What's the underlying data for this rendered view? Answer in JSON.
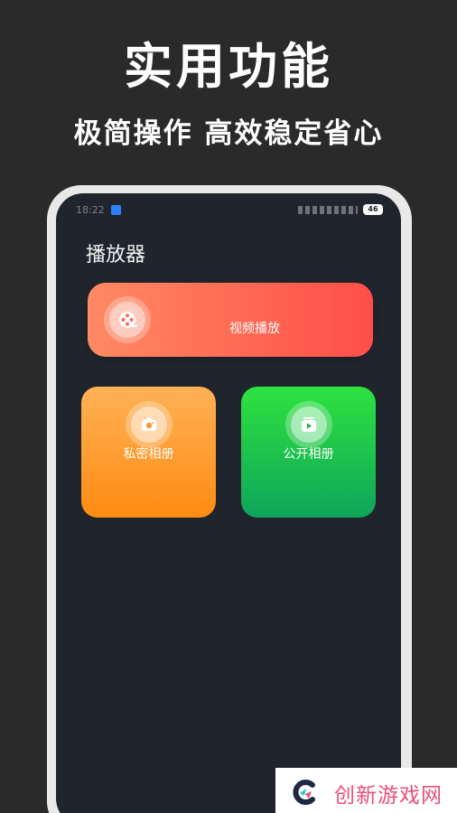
{
  "promo": {
    "headline": "实用功能",
    "subheadline": "极简操作 高效稳定省心"
  },
  "status_bar": {
    "time": "18:22",
    "battery": "46"
  },
  "screen": {
    "title": "播放器"
  },
  "cards": {
    "video": {
      "label": "视频播放",
      "icon": "film-reel-icon"
    },
    "private_album": {
      "label": "私密相册",
      "icon": "camera-icon"
    },
    "public_album": {
      "label": "公开相册",
      "icon": "play-album-icon"
    }
  },
  "watermark": {
    "text": "创新游戏网"
  }
}
